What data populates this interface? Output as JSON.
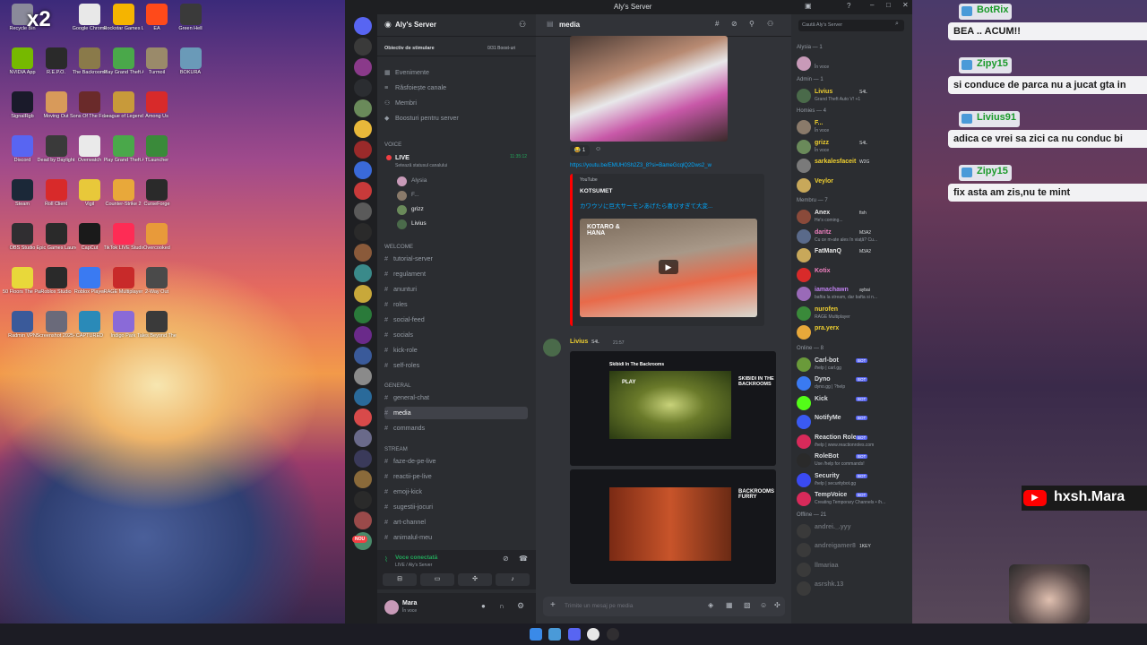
{
  "desktop": {
    "icons": [
      {
        "label": "Recycle Bin",
        "col": 0,
        "row": 0,
        "color": "#8a8a9a"
      },
      {
        "label": "Google Chrome",
        "col": 2,
        "row": 0,
        "color": "#e8e8e8"
      },
      {
        "label": "Rockstar Games Launcher",
        "col": 3,
        "row": 0,
        "color": "#f5b400"
      },
      {
        "label": "EA",
        "col": 4,
        "row": 0,
        "color": "#ff4a1a"
      },
      {
        "label": "Green Hell",
        "col": 5,
        "row": 0,
        "color": "#3a3a3a"
      },
      {
        "label": "NVIDIA App",
        "col": 0,
        "row": 1,
        "color": "#76b900"
      },
      {
        "label": "R.E.P.O.",
        "col": 1,
        "row": 1,
        "color": "#2a2a2a"
      },
      {
        "label": "The Backrooms",
        "col": 2,
        "row": 1,
        "color": "#8a7a4a"
      },
      {
        "label": "Play Grand Theft Auto",
        "col": 3,
        "row": 1,
        "color": "#4aa84a"
      },
      {
        "label": "Turmoil",
        "col": 4,
        "row": 1,
        "color": "#9a8a6a"
      },
      {
        "label": "BOKURA",
        "col": 5,
        "row": 1,
        "color": "#6a9ab8"
      },
      {
        "label": "SignalRgb",
        "col": 0,
        "row": 2,
        "color": "#1a1a2a"
      },
      {
        "label": "Moving Out",
        "col": 1,
        "row": 2,
        "color": "#d89a5a"
      },
      {
        "label": "Sons Of The Forest",
        "col": 2,
        "row": 2,
        "color": "#6a2a2a"
      },
      {
        "label": "League of Legends",
        "col": 3,
        "row": 2,
        "color": "#c89a3a"
      },
      {
        "label": "Among Us",
        "col": 4,
        "row": 2,
        "color": "#d82a2a"
      },
      {
        "label": "Discord",
        "col": 0,
        "row": 3,
        "color": "#5865f2"
      },
      {
        "label": "Dead by Daylight",
        "col": 1,
        "row": 3,
        "color": "#3a3a3a"
      },
      {
        "label": "Overwatch",
        "col": 2,
        "row": 3,
        "color": "#eaeaea"
      },
      {
        "label": "Play Grand Theft Auto",
        "col": 3,
        "row": 3,
        "color": "#4aa84a"
      },
      {
        "label": "TLauncher",
        "col": 4,
        "row": 3,
        "color": "#3a8a3a"
      },
      {
        "label": "Steam",
        "col": 0,
        "row": 4,
        "color": "#1b2838"
      },
      {
        "label": "Roll Client",
        "col": 1,
        "row": 4,
        "color": "#d82a2a"
      },
      {
        "label": "Vigil",
        "col": 2,
        "row": 4,
        "color": "#e8c83a"
      },
      {
        "label": "Counter-Strike 2",
        "col": 3,
        "row": 4,
        "color": "#e8a83a"
      },
      {
        "label": "CurseForge",
        "col": 4,
        "row": 4,
        "color": "#2a2a2a"
      },
      {
        "label": "OBS Studio",
        "col": 0,
        "row": 5,
        "color": "#302e31"
      },
      {
        "label": "Epic Games Launcher",
        "col": 1,
        "row": 5,
        "color": "#2a2a2a"
      },
      {
        "label": "CapCut",
        "col": 2,
        "row": 5,
        "color": "#1a1a1a"
      },
      {
        "label": "TikTok LIVE Studio",
        "col": 3,
        "row": 5,
        "color": "#fe2c55"
      },
      {
        "label": "Overcooked",
        "col": 4,
        "row": 5,
        "color": "#e89a3a"
      },
      {
        "label": "50 Floors The Paranormal",
        "col": 0,
        "row": 6,
        "color": "#e8d83a"
      },
      {
        "label": "Roblox Studio",
        "col": 1,
        "row": 6,
        "color": "#2a2a2a"
      },
      {
        "label": "Roblox Player",
        "col": 2,
        "row": 6,
        "color": "#3a7af2"
      },
      {
        "label": "RAGE Multiplayer",
        "col": 3,
        "row": 6,
        "color": "#c82a2a"
      },
      {
        "label": "2-Way Out",
        "col": 4,
        "row": 6,
        "color": "#4a4a4a"
      },
      {
        "label": "Radmin VPN",
        "col": 0,
        "row": 7,
        "color": "#3a5a9a"
      },
      {
        "label": "Screenshot 2025-12-23",
        "col": 1,
        "row": 7,
        "color": "#6a6a7a"
      },
      {
        "label": "CAPTURED",
        "col": 2,
        "row": 7,
        "color": "#2a8ab8"
      },
      {
        "label": "Indigo Park",
        "col": 3,
        "row": 7,
        "color": "#8a6ad8"
      },
      {
        "label": "Tales Beyond The Tomb",
        "col": 4,
        "row": 7,
        "color": "#3a3a3a"
      }
    ]
  },
  "discord": {
    "window_title": "Aly's Server",
    "server_name": "Aly's Server",
    "boost_goal": "Obiectiv de stimulare",
    "boost_count": "0/31 Boost-uri",
    "server_menu": [
      "Evenimente",
      "Răsfoiește canale",
      "Membri",
      "Boosturi pentru server"
    ],
    "voice_category": "VOICE",
    "voice_channel": {
      "name": "LIVE",
      "status": "Setează statusul canalului",
      "time": "11:35:12",
      "users": [
        "Alysia",
        "F...",
        "grizz",
        "Livius"
      ]
    },
    "welcome_category": "WELCOME",
    "welcome_channels": [
      "tutorial-server",
      "regulament",
      "anunturi",
      "roles",
      "social-feed",
      "socials",
      "kick-role",
      "self-roles"
    ],
    "general_category": "GENERAL",
    "general_channels": [
      "general-chat",
      "media",
      "commands"
    ],
    "stream_category": "STREAM",
    "stream_channels": [
      "faze-de-pe-live",
      "reactii-pe-live",
      "emoji-kick",
      "sugestii-jocuri",
      "art-channel",
      "animalul-meu"
    ],
    "voice_connected": {
      "title": "Voce conectată",
      "sub": "LIVE / Aly's Server"
    },
    "user": {
      "name": "Mara",
      "status": "În voce"
    },
    "server_badges": [
      "NOU"
    ],
    "channel_header": "media",
    "search_placeholder": "Caută Aly's Server",
    "chat": {
      "link": "https://youtu.be/EMUH0Sh2Z3_8?si=BameGcqlQ2Dws2_w",
      "reaction_count": "1",
      "embed_provider": "YouTube",
      "embed_author": "KOTSUMET",
      "embed_title": "カワウソに巨大サーモンあげたら喜びすぎて大変...",
      "embed_thumb_text": "KOTARO & HANA",
      "message_author": "Livius",
      "message_tag": "S4L",
      "message_time": "21:57",
      "shot1_title": "Skibidi In The Backrooms",
      "shot1_side": "SKIBIDI IN THE BACKROOMS",
      "shot1_play": "PLAY",
      "shot2_side": "BACKROOMS FURRY",
      "input_placeholder": "Trimite un mesaj pe  media"
    },
    "members": {
      "groups": [
        {
          "title": "Alysia — 1",
          "items": [
            {
              "name": "",
              "status": "În voce",
              "color": "#dbdee1",
              "av": "#c89ab8"
            }
          ]
        },
        {
          "title": "Admin — 1",
          "items": [
            {
              "name": "Livius",
              "tag": "S4L",
              "status": "Grand Theft Auto V! +1",
              "color": "#f0d030",
              "av": "#4a6a4a"
            }
          ]
        },
        {
          "title": "Homies — 4",
          "items": [
            {
              "name": "F...",
              "status": "În voce",
              "color": "#f0d030",
              "av": "#8a7a6a"
            },
            {
              "name": "grizz",
              "tag": "S4L",
              "status": "În voce",
              "color": "#f0d030",
              "av": "#6a8a5a"
            },
            {
              "name": "sarkalesfaceit",
              "tag": "W2G",
              "status": "",
              "color": "#f0d030",
              "av": "#7a7a7a"
            },
            {
              "name": "Veylor",
              "status": "",
              "color": "#f0d030",
              "av": "#c8a85a"
            }
          ]
        },
        {
          "title": "Membru — 7",
          "items": [
            {
              "name": "Anex",
              "tag": "fish",
              "status": "He's coming...",
              "color": "#eaeaea",
              "av": "#8a4a3a"
            },
            {
              "name": "daritz",
              "tag": "M3A2",
              "status": "Cu ce m-ate ales în viață? Cu...",
              "color": "#f080c0",
              "av": "#5a6a8a"
            },
            {
              "name": "FatManQ",
              "tag": "M3A2",
              "status": "",
              "color": "#eaeaea",
              "av": "#c8a85a"
            },
            {
              "name": "Kotix",
              "status": "",
              "color": "#f080c0",
              "av": "#d82a2a"
            },
            {
              "name": "iamachawn",
              "tag": "aybai",
              "status": "baftia la stream, dar bafta si n...",
              "color": "#c080f0",
              "av": "#9a6ab8"
            },
            {
              "name": "nurofen",
              "status": "RAGE Multiplayer",
              "color": "#f0d030",
              "av": "#3a8a3a"
            },
            {
              "name": "pra.yerx",
              "status": "",
              "color": "#f0d030",
              "av": "#e8a83a"
            }
          ]
        },
        {
          "title": "Online — 8",
          "items": [
            {
              "name": "Carl-bot",
              "bot": "BOT",
              "status": "/help | carl.gg",
              "color": "#dbdee1",
              "av": "#6a9a3a"
            },
            {
              "name": "Dyno",
              "bot": "BOT",
              "status": "dyno.gg | ?help",
              "color": "#dbdee1",
              "av": "#3a7af2"
            },
            {
              "name": "Kick",
              "bot": "BOT",
              "status": "",
              "color": "#dbdee1",
              "av": "#53fc18"
            },
            {
              "name": "NotifyMe",
              "bot": "BOT",
              "status": "",
              "color": "#dbdee1",
              "av": "#3a5af2"
            },
            {
              "name": "Reaction Roles",
              "bot": "BOT",
              "status": "/help | www.reactionroles.com",
              "color": "#dbdee1",
              "av": "#d82a5a"
            },
            {
              "name": "RoleBot",
              "bot": "BOT",
              "status": "Use /help for commands!",
              "color": "#dbdee1",
              "av": "#2a2a2a"
            },
            {
              "name": "Security",
              "bot": "BOT",
              "status": "/help | securitybot.gg",
              "color": "#dbdee1",
              "av": "#3a4af2"
            },
            {
              "name": "TempVoice",
              "bot": "BOT",
              "status": "Creating Temporary Channels • /h...",
              "color": "#dbdee1",
              "av": "#d82a5a"
            }
          ]
        },
        {
          "title": "Offline — 21",
          "items": [
            {
              "name": "andrei._.yyy",
              "status": "",
              "color": "#6a6e74",
              "av": "#3a3a3a"
            },
            {
              "name": "andreigamer8",
              "tag": "1KEY",
              "status": "",
              "color": "#6a6e74",
              "av": "#3a3a3a"
            },
            {
              "name": "llmariaa",
              "status": "",
              "color": "#6a6e74",
              "av": "#3a3a3a"
            },
            {
              "name": "asrshk.13",
              "status": "",
              "color": "#6a6e74",
              "av": "#3a3a3a"
            }
          ]
        }
      ]
    }
  },
  "overlay": {
    "kill_badge": "x2",
    "chat": [
      {
        "user": "BotRix",
        "msg": "BEA .. ACUM!!"
      },
      {
        "user": "Zipy15",
        "msg": "si conduce de parca nu a jucat gta in"
      },
      {
        "user": "Livius91",
        "msg": "adica ce vrei sa zici ca nu conduc bi"
      },
      {
        "user": "Zipy15",
        "msg": "fix asta am zis,nu te mint"
      }
    ],
    "channel_handle": "hxsh.Mara"
  },
  "colors": {
    "discord_bg": "#313338",
    "blurple": "#5865f2",
    "live_red": "#f23f43",
    "link": "#00a8fc",
    "youtube_red": "#ff0000"
  }
}
